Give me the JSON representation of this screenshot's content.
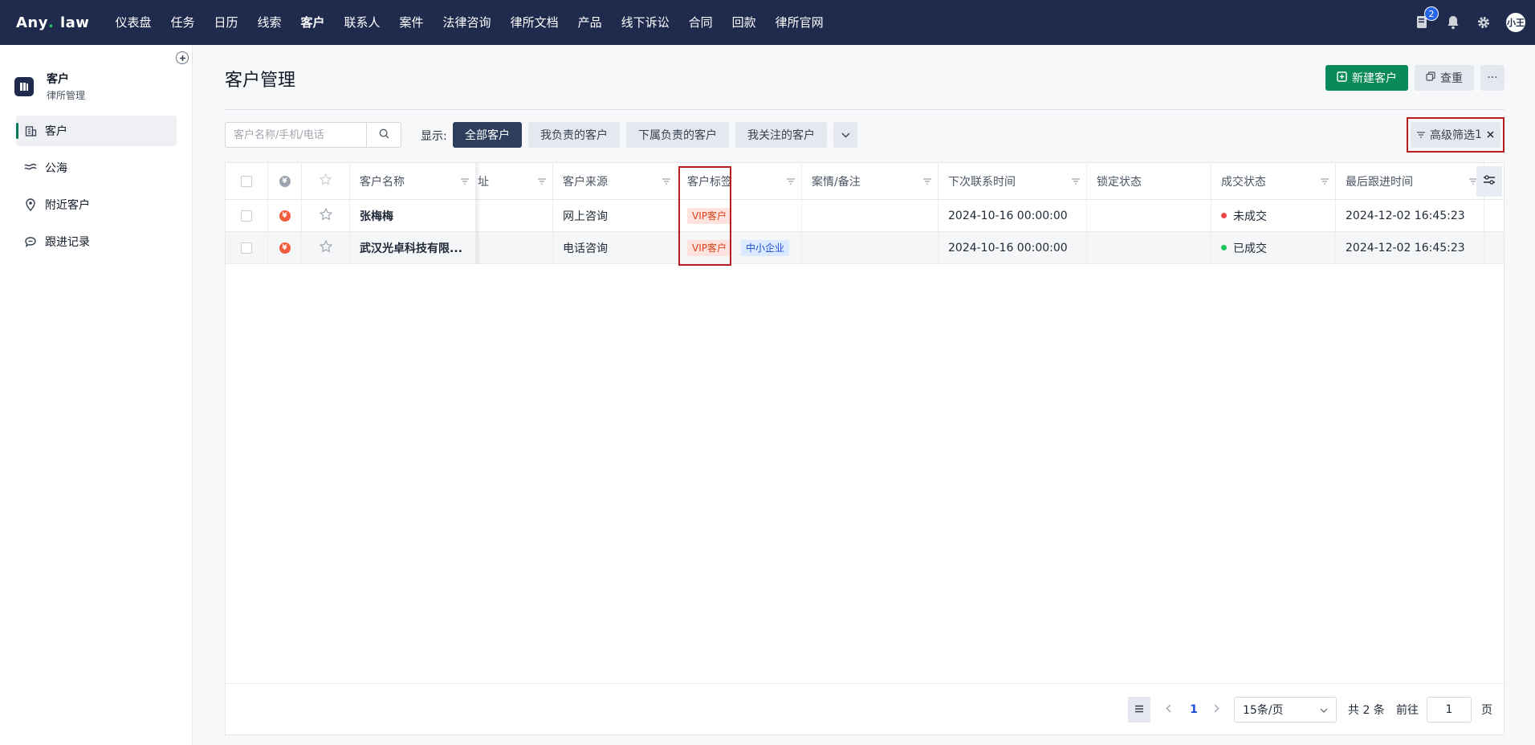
{
  "app": {
    "logo_text": "Any",
    "logo_dot": ".",
    "logo_text2": "law",
    "nav": [
      "仪表盘",
      "任务",
      "日历",
      "线索",
      "客户",
      "联系人",
      "案件",
      "法律咨询",
      "律所文档",
      "产品",
      "线下诉讼",
      "合同",
      "回款",
      "律所官网"
    ],
    "active_nav": "客户",
    "notification_count": "2",
    "user_avatar": "小王"
  },
  "sidebar": {
    "module_title": "客户",
    "module_subtitle": "律所管理",
    "items": [
      {
        "label": "客户",
        "icon": "building-icon",
        "active": true
      },
      {
        "label": "公海",
        "icon": "waves-icon",
        "active": false
      },
      {
        "label": "附近客户",
        "icon": "location-pin-icon",
        "active": false
      },
      {
        "label": "跟进记录",
        "icon": "chat-bubble-icon",
        "active": false
      }
    ]
  },
  "page": {
    "title": "客户管理",
    "new_button": "新建客户",
    "dedupe_button": "查重",
    "more_button": "···"
  },
  "toolbar": {
    "search_placeholder": "客户名称/手机/电话",
    "show_label": "显示:",
    "filters": [
      "全部客户",
      "我负责的客户",
      "下属负责的客户",
      "我关注的客户"
    ],
    "active_filter": "全部客户",
    "advanced_filter": "高级筛选",
    "advanced_count": "1"
  },
  "table": {
    "columns": [
      "客户名称",
      "址",
      "客户来源",
      "客户标签",
      "案情/备注",
      "下次联系时间",
      "锁定状态",
      "成交状态",
      "最后跟进时间"
    ],
    "rows": [
      {
        "name": "张梅梅",
        "source": "网上咨询",
        "tags": [
          "VIP客户"
        ],
        "note": "",
        "next_contact": "2024-10-16 00:00:00",
        "lock_status": "",
        "deal_status": "未成交",
        "deal_color": "#ef4444",
        "last_follow": "2024-12-02 16:45:23"
      },
      {
        "name": "武汉光卓科技有限...",
        "source": "电话咨询",
        "tags": [
          "VIP客户",
          "中小企业"
        ],
        "note": "",
        "next_contact": "2024-10-16 00:00:00",
        "lock_status": "",
        "deal_status": "已成交",
        "deal_color": "#22c55e",
        "last_follow": "2024-12-02 16:45:23"
      }
    ]
  },
  "pagination": {
    "current_page": "1",
    "page_size": "15条/页",
    "total": "共 2 条",
    "goto_label": "前往",
    "goto_value": "1",
    "unit": "页"
  },
  "colors": {
    "nav_bg": "#1f2a4d",
    "primary": "#0a8a5a",
    "highlight_border": "#b91c1c",
    "vip_tag": "#d9431d",
    "sme_tag": "#1d4ed8"
  }
}
